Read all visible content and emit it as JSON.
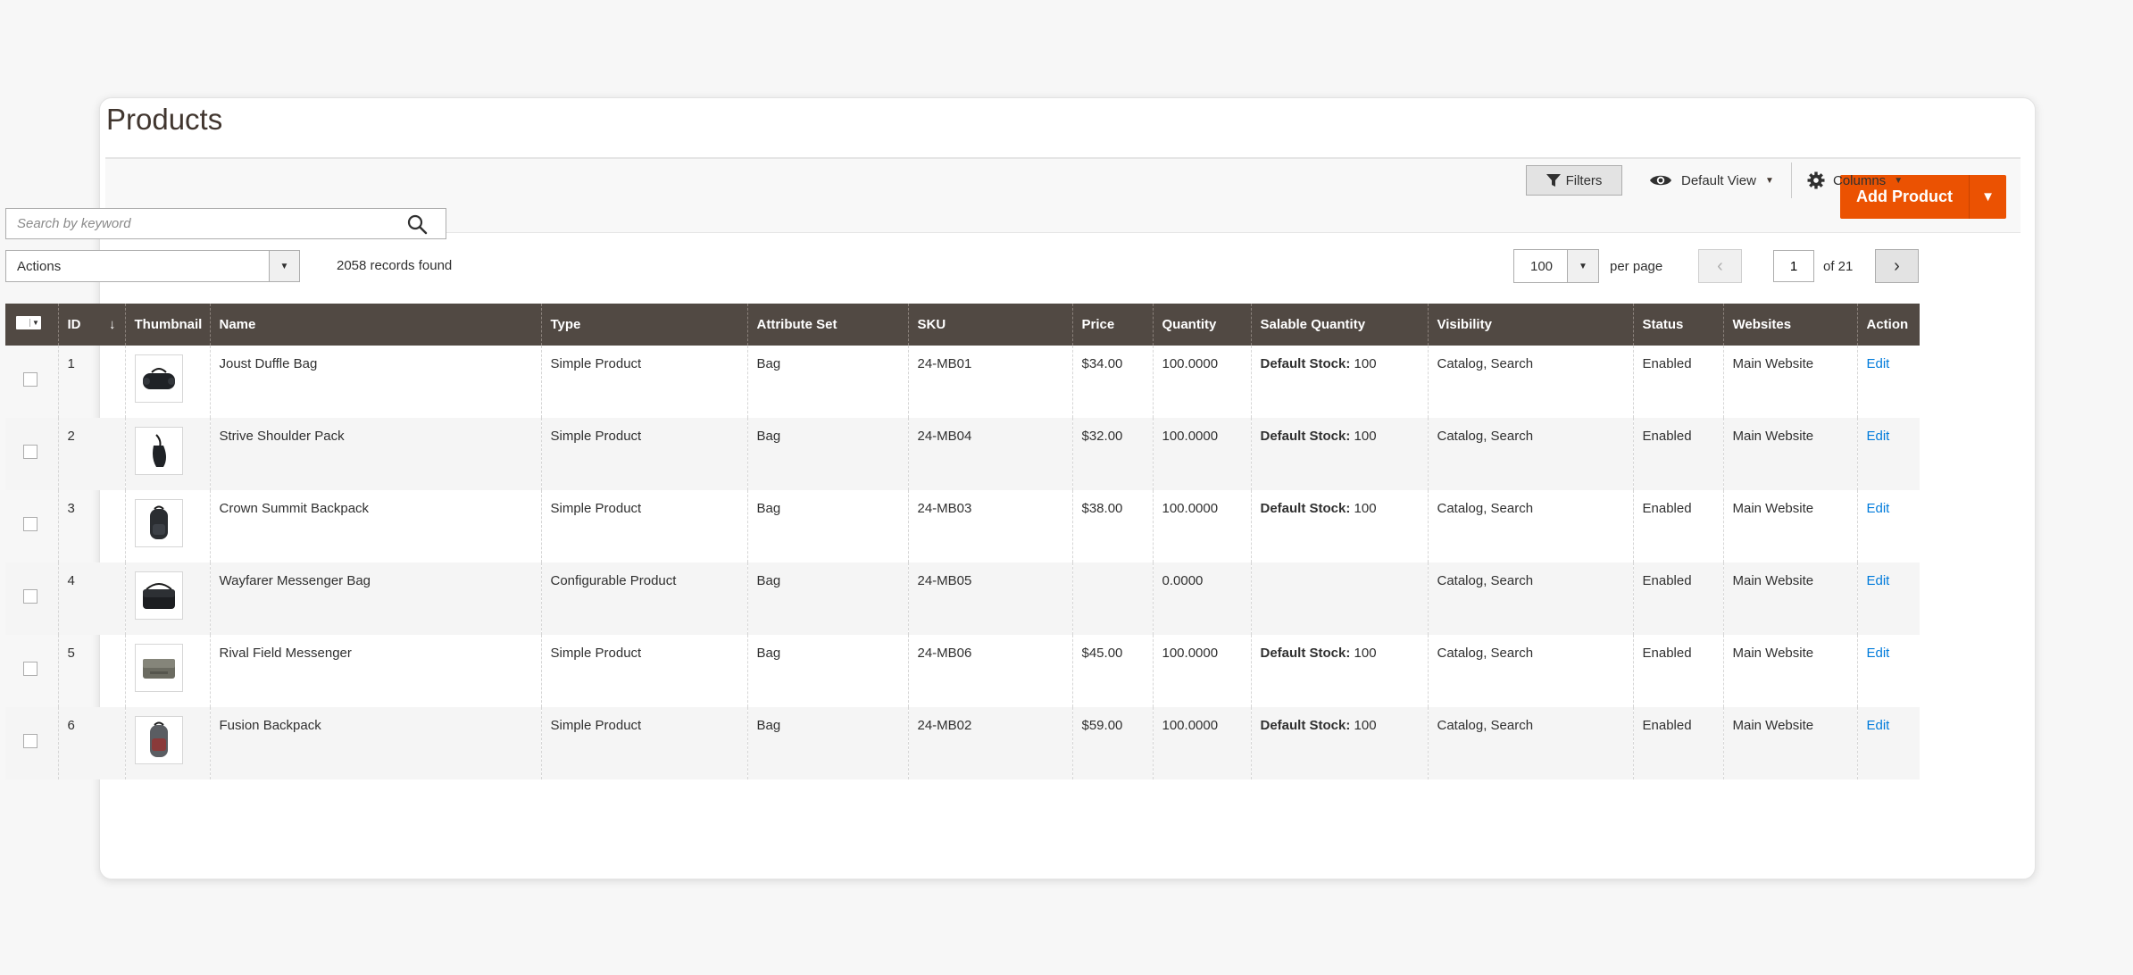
{
  "page": {
    "title": "Products",
    "add_button": "Add Product"
  },
  "toolbar": {
    "filters": "Filters",
    "view": "Default View",
    "columns": "Columns",
    "search_placeholder": "Search by keyword",
    "actions": "Actions",
    "records": "2058 records found",
    "per_page_value": "100",
    "per_page_label": "per page",
    "current_page": "1",
    "of_pages": "of 21"
  },
  "grid": {
    "columns": [
      "ID",
      "Thumbnail",
      "Name",
      "Type",
      "Attribute Set",
      "SKU",
      "Price",
      "Quantity",
      "Salable Quantity",
      "Visibility",
      "Status",
      "Websites",
      "Action"
    ],
    "salable_prefix": "Default Stock:",
    "rows": [
      {
        "id": "1",
        "name": "Joust Duffle Bag",
        "type": "Simple Product",
        "attr": "Bag",
        "sku": "24-MB01",
        "price": "$34.00",
        "qty": "100.0000",
        "salable": "100",
        "visibility": "Catalog, Search",
        "status": "Enabled",
        "websites": "Main Website",
        "action": "Edit",
        "thumb_icon": "duffle-bag-icon"
      },
      {
        "id": "2",
        "name": "Strive Shoulder Pack",
        "type": "Simple Product",
        "attr": "Bag",
        "sku": "24-MB04",
        "price": "$32.00",
        "qty": "100.0000",
        "salable": "100",
        "visibility": "Catalog, Search",
        "status": "Enabled",
        "websites": "Main Website",
        "action": "Edit",
        "thumb_icon": "shoulder-pack-icon"
      },
      {
        "id": "3",
        "name": "Crown Summit Backpack",
        "type": "Simple Product",
        "attr": "Bag",
        "sku": "24-MB03",
        "price": "$38.00",
        "qty": "100.0000",
        "salable": "100",
        "visibility": "Catalog, Search",
        "status": "Enabled",
        "websites": "Main Website",
        "action": "Edit",
        "thumb_icon": "backpack-icon"
      },
      {
        "id": "4",
        "name": "Wayfarer Messenger Bag",
        "type": "Configurable Product",
        "attr": "Bag",
        "sku": "24-MB05",
        "price": "",
        "qty": "0.0000",
        "salable": "",
        "visibility": "Catalog, Search",
        "status": "Enabled",
        "websites": "Main Website",
        "action": "Edit",
        "thumb_icon": "messenger-bag-icon"
      },
      {
        "id": "5",
        "name": "Rival Field Messenger",
        "type": "Simple Product",
        "attr": "Bag",
        "sku": "24-MB06",
        "price": "$45.00",
        "qty": "100.0000",
        "salable": "100",
        "visibility": "Catalog, Search",
        "status": "Enabled",
        "websites": "Main Website",
        "action": "Edit",
        "thumb_icon": "field-messenger-icon"
      },
      {
        "id": "6",
        "name": "Fusion Backpack",
        "type": "Simple Product",
        "attr": "Bag",
        "sku": "24-MB02",
        "price": "$59.00",
        "qty": "100.0000",
        "salable": "100",
        "visibility": "Catalog, Search",
        "status": "Enabled",
        "websites": "Main Website",
        "action": "Edit",
        "thumb_icon": "fusion-backpack-icon"
      }
    ]
  },
  "colors": {
    "accent": "#eb5202",
    "header_bg": "#514943",
    "link": "#007bdb"
  }
}
